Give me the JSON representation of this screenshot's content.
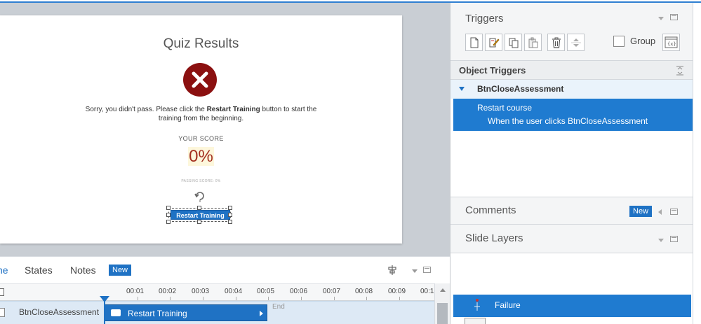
{
  "slide": {
    "quiz_title": "Quiz Results",
    "message_before": "Sorry, you didn't pass. Please click  the ",
    "message_bold": "Restart Training",
    "message_after": " button to start the training from the beginning.",
    "score_label": "YOUR SCORE",
    "score_value": "0%",
    "passing_score": "PASSING SCORE: 0%",
    "restart_button": "Restart Training",
    "fail_color": "#8b1010",
    "accent_color": "#1f72c4"
  },
  "timeline": {
    "tabs": [
      {
        "label": "ne",
        "active": true
      },
      {
        "label": "States",
        "active": false
      },
      {
        "label": "Notes",
        "active": false
      }
    ],
    "new_badge": "New",
    "ticks": [
      "00:01",
      "00:02",
      "00:03",
      "00:04",
      "00:05",
      "00:06",
      "00:07",
      "00:08",
      "00:09",
      "00:1"
    ],
    "row_name": "BtnCloseAssessment",
    "bar_label": "Restart Training",
    "end_label": "End"
  },
  "triggers": {
    "title": "Triggers",
    "group_label": "Group",
    "object_triggers_label": "Object Triggers",
    "object_name": "BtnCloseAssessment",
    "trigger_action": "Restart course",
    "trigger_condition": "When the user clicks BtnCloseAssessment"
  },
  "comments": {
    "title": "Comments",
    "new_badge": "New"
  },
  "slide_layers": {
    "title": "Slide Layers",
    "selected_layer": "Failure"
  },
  "icons": {
    "new_trigger": "new-document-icon",
    "edit_trigger": "edit-icon",
    "copy_trigger": "copy-icon",
    "paste_trigger": "paste-icon",
    "delete_trigger": "trash-icon",
    "move_trigger": "up-down-arrows-icon",
    "variables": "variables-icon"
  }
}
